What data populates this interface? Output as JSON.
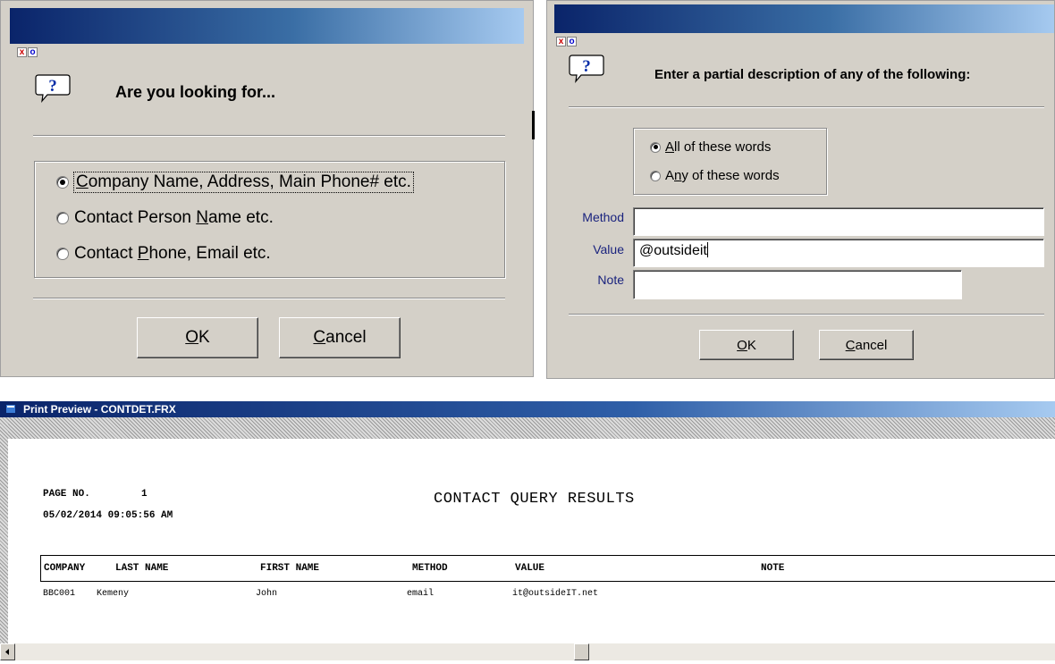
{
  "dialog_search_type": {
    "close_label": "x",
    "restore_label": "o",
    "question_mark": "?",
    "prompt": "Are you looking for...",
    "options": [
      {
        "pre": "",
        "key": "C",
        "post": "ompany Name, Address, Main Phone# etc.",
        "selected": true
      },
      {
        "pre": "Contact Person ",
        "key": "N",
        "post": "ame etc.",
        "selected": false
      },
      {
        "pre": "Contact ",
        "key": "P",
        "post": "hone, Email etc.",
        "selected": false
      }
    ],
    "ok_key": "O",
    "ok_rest": "K",
    "cancel_key": "C",
    "cancel_rest": "ancel"
  },
  "dialog_partial": {
    "close_label": "x",
    "restore_label": "o",
    "question_mark": "?",
    "prompt": "Enter a partial description of any of the following:",
    "options": [
      {
        "pre": "",
        "key": "A",
        "post": "ll of these words",
        "selected": true
      },
      {
        "pre": "A",
        "key": "n",
        "post": "y of these words",
        "selected": false
      }
    ],
    "method_label": "Method",
    "method_value": "",
    "value_label": "Value",
    "value_value": "@outsideit",
    "note_label": "Note",
    "note_value": "",
    "ok_key": "O",
    "ok_rest": "K",
    "cancel_key": "C",
    "cancel_rest": "ancel"
  },
  "print_preview": {
    "title": "Print Preview - CONTDET.FRX",
    "page_label": "PAGE NO.",
    "page_number": "1",
    "timestamp": "05/02/2014 09:05:56 AM",
    "report_title": "CONTACT QUERY RESULTS",
    "columns": [
      "COMPANY",
      "LAST NAME",
      "FIRST NAME",
      "METHOD",
      "VALUE",
      "NOTE"
    ],
    "rows": [
      {
        "company": "BBC001",
        "last_name": "Kemeny",
        "first_name": "John",
        "method": "email",
        "value": "it@outsideIT.net",
        "note": ""
      }
    ]
  }
}
